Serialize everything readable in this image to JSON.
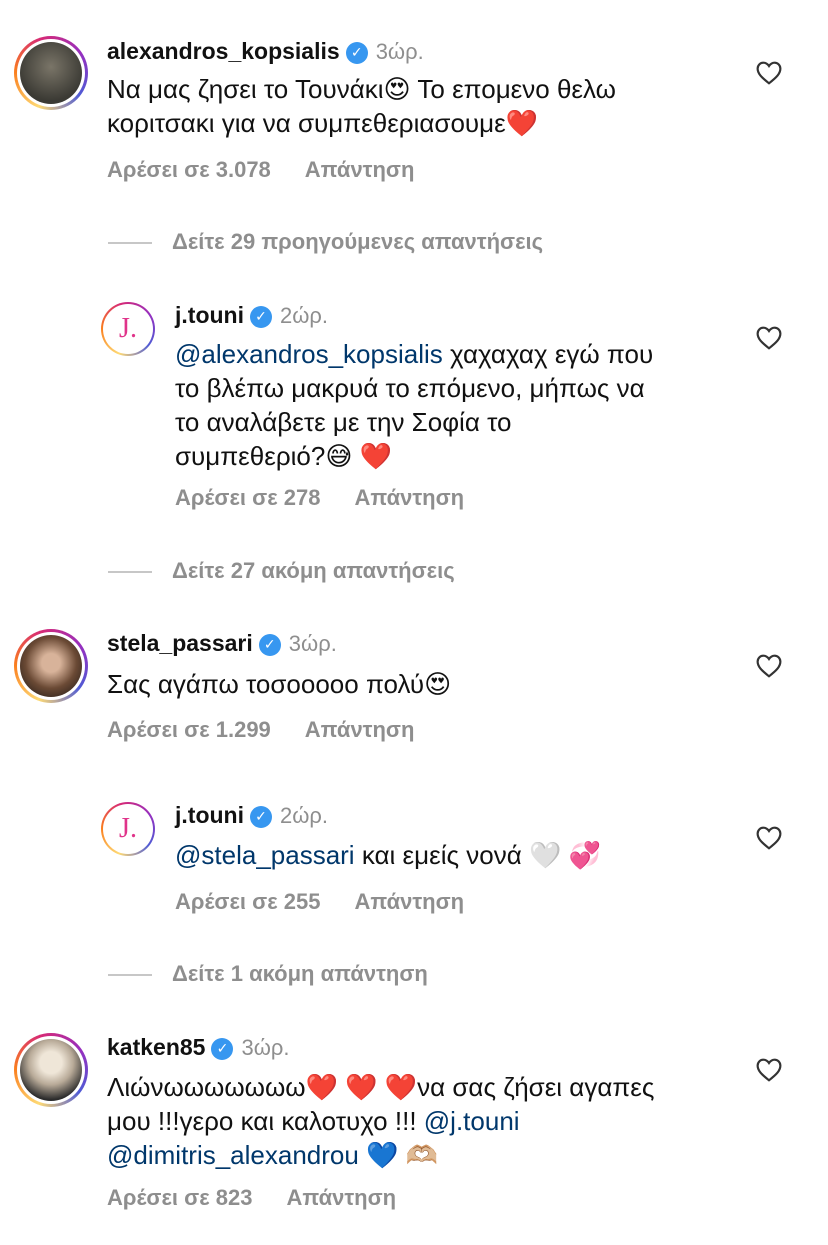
{
  "comments": [
    {
      "username": "alexandros_kopsialis",
      "time": "3ώρ.",
      "text_line1": "Να μας ζησει το Τουνάκι😍 Το επομενο θελω",
      "text_line2": "κοριτσακι για να συμπεθεριασουμε❤️",
      "likes": "Αρέσει σε 3.078",
      "reply": "Απάντηση"
    },
    {
      "username": "j.touni",
      "time": "2ώρ.",
      "mention": "@alexandros_kopsialis",
      "text_after_mention": "χαχαχαχ εγώ που",
      "text_line2": "το βλέπω μακρυά το επόμενο, μήπως να",
      "text_line3": "το αναλάβετε με την Σοφία το",
      "text_line4": "συμπεθεριό?😅 ❤️",
      "likes": "Αρέσει σε 278",
      "reply": "Απάντηση",
      "logo_letter": "J."
    },
    {
      "username": "stela_passari",
      "time": "3ώρ.",
      "text_line1": "Σας αγάπω τοσοοοοο πολύ😍",
      "likes": "Αρέσει σε 1.299",
      "reply": "Απάντηση"
    },
    {
      "username": "j.touni",
      "time": "2ώρ.",
      "mention": "@stela_passari",
      "text_after_mention": "και εμείς νονά 🤍 💞",
      "likes": "Αρέσει σε 255",
      "reply": "Απάντηση",
      "logo_letter": "J."
    },
    {
      "username": "katken85",
      "time": "3ώρ.",
      "text_line1": "Λιώνωωωωωωω❤️ ❤️ ❤️να σας ζήσει αγαπες",
      "text_line2_plain": "μου !!!γερο και καλοτυχο !!!",
      "mention1": "@j.touni",
      "mention2": "@dimitris_alexandrou",
      "text_line3_after": "💙 🫶🏼",
      "likes": "Αρέσει σε 823",
      "reply": "Απάντηση"
    }
  ],
  "threads": [
    "Δείτε 29 προηγούμενες απαντήσεις",
    "Δείτε 27 ακόμη απαντήσεις",
    "Δείτε 1 ακόμη απάντηση"
  ],
  "colors": {
    "mention": "#00376b",
    "secondary": "#8e8e8e",
    "verified": "#3797f0"
  }
}
